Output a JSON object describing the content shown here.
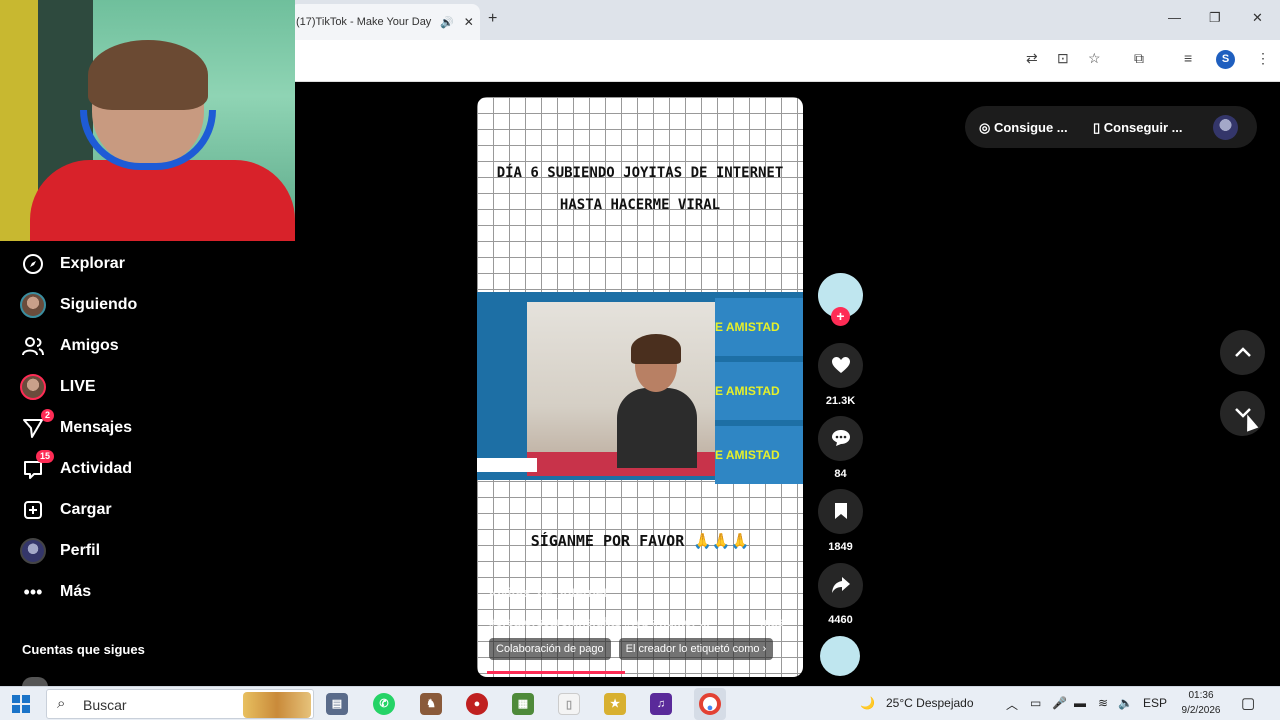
{
  "browser": {
    "tab_title": "(17)TikTok - Make Your Day",
    "tab_audio_icon": "speaker-icon",
    "tab_close": "✕",
    "new_tab": "+",
    "window_controls": {
      "minimize": "—",
      "restore": "❐",
      "close": "✕"
    },
    "profile_initial": "S"
  },
  "sidebar": {
    "items": [
      {
        "label": "Explorar",
        "icon": "compass-icon"
      },
      {
        "label": "Siguiendo",
        "icon": "avatar"
      },
      {
        "label": "Amigos",
        "icon": "friends-icon"
      },
      {
        "label": "LIVE",
        "icon": "avatar"
      },
      {
        "label": "Mensajes",
        "icon": "send-icon",
        "badge": "2"
      },
      {
        "label": "Actividad",
        "icon": "inbox-icon",
        "badge": "15"
      },
      {
        "label": "Cargar",
        "icon": "plus-square-icon"
      },
      {
        "label": "Perfil",
        "icon": "avatar"
      },
      {
        "label": "Más",
        "icon": "more-icon"
      }
    ],
    "following_heading": "Cuentas que sigues"
  },
  "video": {
    "title_line1": "DÍA 6 SUBIENDO JOYITAS DE INTERNET",
    "title_line2": "HASTA HACERME VIRAL",
    "clip_caption": "E AMISTAD",
    "subtitle": "SÍGANME POR FAVOR 🙏🙏🙏",
    "author": "joyitas_de_internet",
    "tags": "#creatorsearchinsights #fyp #humor ...",
    "more": "más",
    "chips": [
      "Colaboración de pago",
      "El creador lo etiquetó como ›"
    ],
    "progress": 0.45
  },
  "actions": {
    "follow_plus": "+",
    "likes": "21.3K",
    "comments": "84",
    "saves": "1849",
    "shares": "4460"
  },
  "topbar": {
    "coins": "Consigue ...",
    "app": "Conseguir ..."
  },
  "taskbar": {
    "search_placeholder": "Buscar",
    "weather": "25°C  Despejado",
    "language": "ESP",
    "time": "01:36",
    "date": "9/2/2026"
  },
  "colors": {
    "accent": "#fe2c55",
    "background": "#000000",
    "windows_blue": "#1a73c8"
  }
}
